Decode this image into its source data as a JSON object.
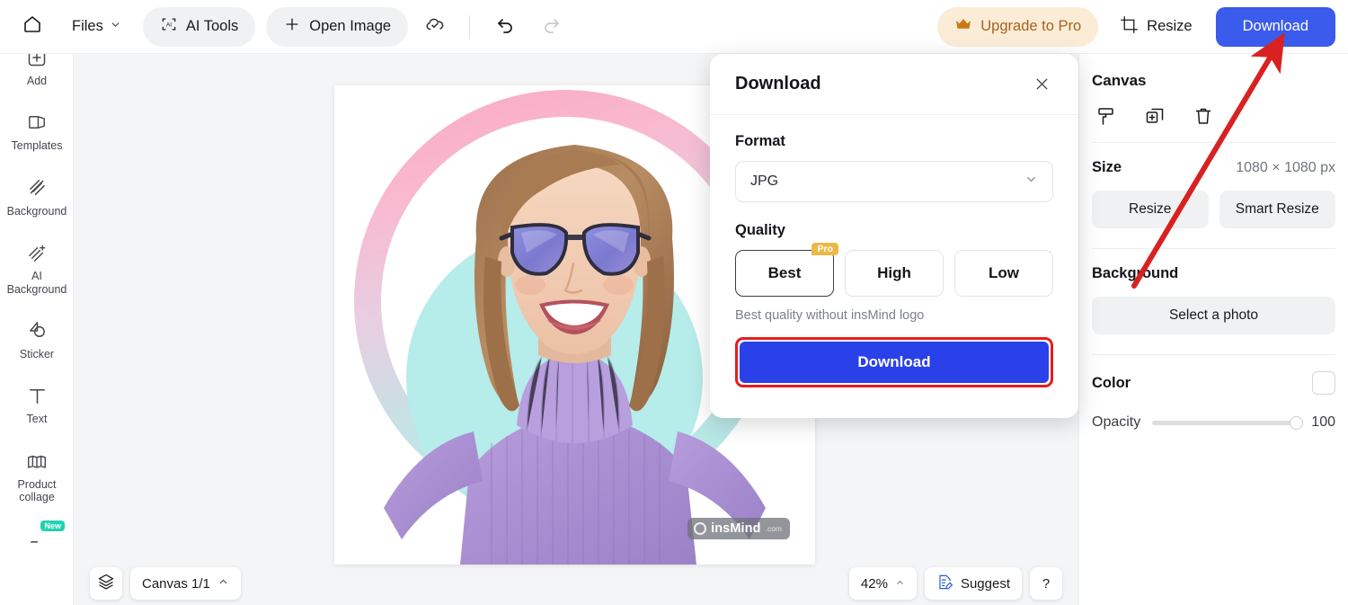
{
  "toolbar": {
    "home_icon": "home-icon",
    "files_label": "Files",
    "files_caret": "chevron-down-icon",
    "ai_tools_icon": "ai-scan-icon",
    "ai_tools_label": "AI Tools",
    "open_image_icon": "plus-icon",
    "open_image_label": "Open Image",
    "cloud_icon": "cloud-check-icon",
    "undo_icon": "undo-icon",
    "redo_icon": "redo-icon",
    "upgrade_icon": "crown-icon",
    "upgrade_label": "Upgrade to Pro",
    "resize_icon": "crop-icon",
    "resize_label": "Resize",
    "download_label": "Download",
    "accent_blue": "#3b5bec",
    "upgrade_bg": "#fbecd7",
    "upgrade_fg": "#a9621b"
  },
  "sidebar": {
    "items": [
      {
        "label": "Add",
        "icon": "plus-square-icon",
        "badge": null
      },
      {
        "label": "Templates",
        "icon": "templates-icon",
        "badge": null
      },
      {
        "label": "Background",
        "icon": "hatch-icon",
        "badge": null
      },
      {
        "label": "AI\nBackground",
        "icon": "hatch-sparkle-icon",
        "badge": null
      },
      {
        "label": "Sticker",
        "icon": "sticker-icon",
        "badge": null
      },
      {
        "label": "Text",
        "icon": "text-T-icon",
        "badge": null
      },
      {
        "label": "Product collage",
        "icon": "collage-icon",
        "badge": null
      },
      {
        "label": "",
        "icon": "partial-icon",
        "badge": "New"
      }
    ]
  },
  "canvas": {
    "watermark_text": "insMind",
    "watermark_suffix": ".com",
    "watermark_icon": "insmind-logo-icon",
    "subject_description": "Smiling woman with sunglasses in purple turtleneck on pink-teal ring background"
  },
  "bottombar": {
    "layers_icon": "layers-icon",
    "canvas_label": "Canvas 1/1",
    "canvas_caret": "chevron-up-icon",
    "zoom_label": "42%",
    "zoom_caret": "chevron-up-icon",
    "suggest_icon": "suggest-note-icon",
    "suggest_label": "Suggest",
    "help_label": "?"
  },
  "rightpanel": {
    "canvas_title": "Canvas",
    "tool_icons": [
      "paint-roller-icon",
      "duplicate-icon",
      "trash-icon"
    ],
    "size_label": "Size",
    "size_value": "1080 × 1080 px",
    "resize_label": "Resize",
    "smart_resize_label": "Smart Resize",
    "background_label": "Background",
    "select_photo_label": "Select a photo",
    "color_label": "Color",
    "color_value": "#ffffff",
    "opacity_label": "Opacity",
    "opacity_value": "100"
  },
  "dialog": {
    "title": "Download",
    "close_icon": "close-icon",
    "format_label": "Format",
    "format_value": "JPG",
    "format_caret": "chevron-down-icon",
    "quality_label": "Quality",
    "quality_options": [
      {
        "label": "Best",
        "badge": "Pro",
        "selected": true
      },
      {
        "label": "High",
        "badge": null,
        "selected": false
      },
      {
        "label": "Low",
        "badge": null,
        "selected": false
      }
    ],
    "quality_note": "Best quality without insMind logo",
    "download_label": "Download",
    "highlight_color": "#e81c1c",
    "button_color": "#2a40e8"
  },
  "annotation": {
    "arrow_color": "#d92121",
    "arrow_from": "Canvas panel area",
    "arrow_to": "Download button in top bar"
  }
}
